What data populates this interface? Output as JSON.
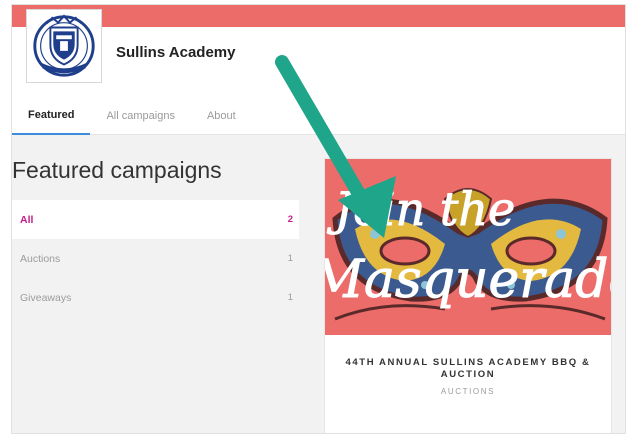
{
  "org": {
    "name": "Sullins Academy"
  },
  "tabs": [
    {
      "label": "Featured",
      "active": true
    },
    {
      "label": "All campaigns",
      "active": false
    },
    {
      "label": "About",
      "active": false
    }
  ],
  "page": {
    "section_title": "Featured campaigns"
  },
  "filters": [
    {
      "label": "All",
      "count": "2",
      "active": true
    },
    {
      "label": "Auctions",
      "count": "1",
      "active": false
    },
    {
      "label": "Giveaways",
      "count": "1",
      "active": false
    }
  ],
  "campaign": {
    "image_text_line1": "Join the",
    "image_text_line2": "Masquerade",
    "title": "44TH ANNUAL SULLINS ACADEMY BBQ & AUCTION",
    "category": "AUCTIONS"
  },
  "colors": {
    "banner": "#ec6c6a",
    "active_filter": "#c41d8a",
    "active_tab_underline": "#3d8cd9",
    "arrow": "#1fa589"
  },
  "icons": {
    "logo": "crest-logo-icon",
    "annotation": "arrow-pointer-icon"
  }
}
